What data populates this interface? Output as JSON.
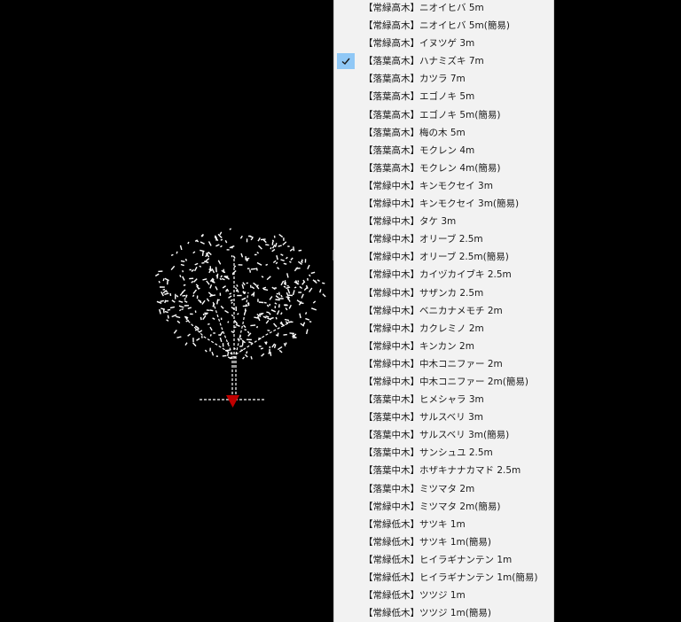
{
  "canvas": {
    "background": "#000000",
    "tree_icon": "tree-elevation-icon",
    "marker_color": "#c00000"
  },
  "menu": {
    "background": "#f2f2f2",
    "check_color": "#90c8f6",
    "items": [
      {
        "label": "【常緑高木】ニオイヒバ 5m",
        "checked": false
      },
      {
        "label": "【常緑高木】ニオイヒバ 5m(簡易)",
        "checked": false
      },
      {
        "label": "【常緑高木】イヌツゲ 3m",
        "checked": false
      },
      {
        "label": "【落葉高木】ハナミズキ 7m",
        "checked": true
      },
      {
        "label": "【落葉高木】カツラ 7m",
        "checked": false
      },
      {
        "label": "【落葉高木】エゴノキ 5m",
        "checked": false
      },
      {
        "label": "【落葉高木】エゴノキ 5m(簡易)",
        "checked": false
      },
      {
        "label": "【落葉高木】梅の木 5m",
        "checked": false
      },
      {
        "label": "【落葉高木】モクレン 4m",
        "checked": false
      },
      {
        "label": "【落葉高木】モクレン 4m(簡易)",
        "checked": false
      },
      {
        "label": "【常緑中木】キンモクセイ 3m",
        "checked": false
      },
      {
        "label": "【常緑中木】キンモクセイ 3m(簡易)",
        "checked": false
      },
      {
        "label": "【常緑中木】タケ 3m",
        "checked": false
      },
      {
        "label": "【常緑中木】オリーブ 2.5m",
        "checked": false
      },
      {
        "label": "【常緑中木】オリーブ 2.5m(簡易)",
        "checked": false
      },
      {
        "label": "【常緑中木】カイヅカイブキ 2.5m",
        "checked": false
      },
      {
        "label": "【常緑中木】サザンカ 2.5m",
        "checked": false
      },
      {
        "label": "【常緑中木】ベニカナメモチ 2m",
        "checked": false
      },
      {
        "label": "【常緑中木】カクレミノ 2m",
        "checked": false
      },
      {
        "label": "【常緑中木】キンカン 2m",
        "checked": false
      },
      {
        "label": "【常緑中木】中木コニファー 2m",
        "checked": false
      },
      {
        "label": "【常緑中木】中木コニファー 2m(簡易)",
        "checked": false
      },
      {
        "label": "【落葉中木】ヒメシャラ 3m",
        "checked": false
      },
      {
        "label": "【落葉中木】サルスベリ 3m",
        "checked": false
      },
      {
        "label": "【落葉中木】サルスベリ 3m(簡易)",
        "checked": false
      },
      {
        "label": "【落葉中木】サンシュユ 2.5m",
        "checked": false
      },
      {
        "label": "【落葉中木】ホザキナナカマド 2.5m",
        "checked": false
      },
      {
        "label": "【落葉中木】ミツマタ 2m",
        "checked": false
      },
      {
        "label": "【常緑中木】ミツマタ 2m(簡易)",
        "checked": false
      },
      {
        "label": "【常緑低木】サツキ 1m",
        "checked": false
      },
      {
        "label": "【常緑低木】サツキ 1m(簡易)",
        "checked": false
      },
      {
        "label": "【常緑低木】ヒイラギナンテン 1m",
        "checked": false
      },
      {
        "label": "【常緑低木】ヒイラギナンテン 1m(簡易)",
        "checked": false
      },
      {
        "label": "【常緑低木】ツツジ 1m",
        "checked": false
      },
      {
        "label": "【常緑低木】ツツジ 1m(簡易)",
        "checked": false
      }
    ]
  }
}
